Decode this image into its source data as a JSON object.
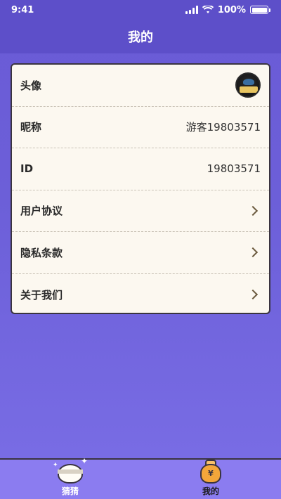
{
  "status_bar": {
    "time": "9:41",
    "battery": "100%"
  },
  "header": {
    "title": "我的"
  },
  "profile": {
    "rows": [
      {
        "label": "头像"
      },
      {
        "label": "昵称",
        "value": "游客19803571"
      },
      {
        "label": "ID",
        "value": "19803571"
      },
      {
        "label": "用户协议"
      },
      {
        "label": "隐私条款"
      },
      {
        "label": "关于我们"
      }
    ]
  },
  "tabbar": {
    "tabs": [
      {
        "label": "猜猜",
        "icon": "bunny-face-icon"
      },
      {
        "label": "我的",
        "icon": "money-bag-icon",
        "active": true
      }
    ]
  },
  "colors": {
    "header_bg": "#5d4fc9",
    "page_bg": "#6c5fd8",
    "card_bg": "#fcf8f0",
    "tabbar_bg": "#8b7cf0",
    "bag": "#f3a63a"
  }
}
